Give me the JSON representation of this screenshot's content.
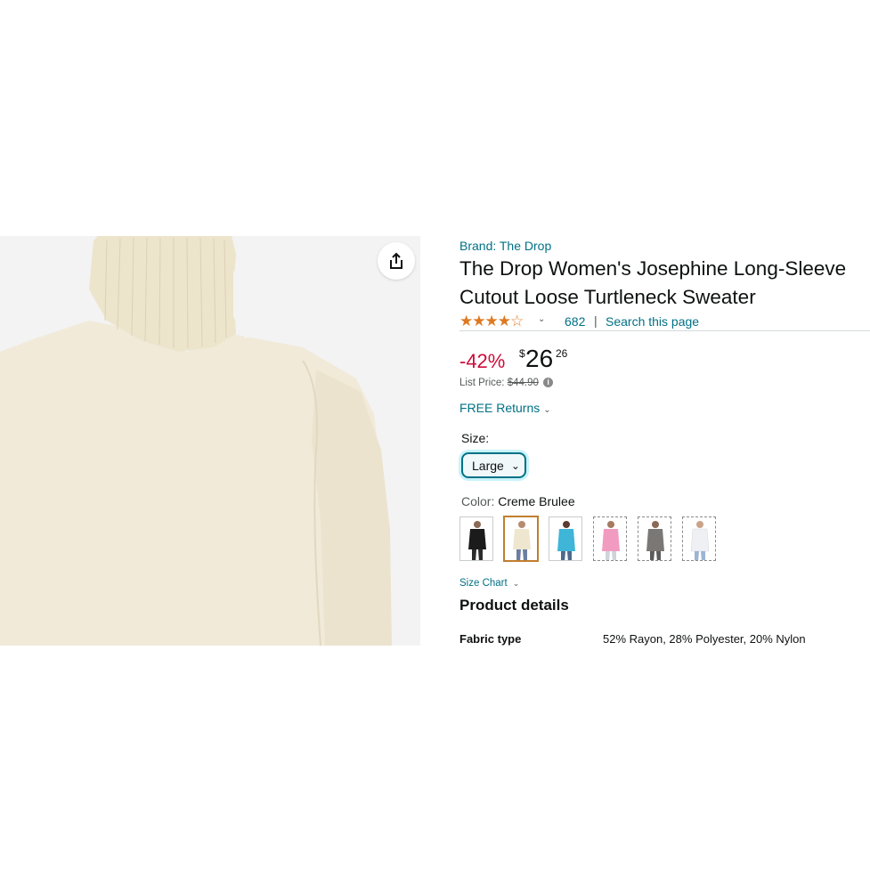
{
  "product": {
    "brand": "Brand: The Drop",
    "title_line1": "The Drop Women's Josephine Long-Sleeve",
    "title_line2": "Cutout Loose Turtleneck Sweater",
    "image_color": "#f1ead9"
  },
  "rating": {
    "stars": 4,
    "count": "682",
    "separator": "|",
    "search_link": "Search this page",
    "star_color": "#de7921"
  },
  "price": {
    "discount": "-42%",
    "currency": "$",
    "whole": "26",
    "fraction": "26",
    "list_price_label": "List Price:",
    "list_price_value": "$44.90",
    "discount_color": "#cc0c39"
  },
  "returns": {
    "label": "FREE Returns"
  },
  "size": {
    "label": "Size:",
    "selected": "Large"
  },
  "color": {
    "label": "Color:",
    "selected": "Creme Brulee",
    "swatches": [
      {
        "name": "black",
        "hex": "#1b1b1b"
      },
      {
        "name": "creme-brulee",
        "hex": "#efe6cf"
      },
      {
        "name": "blue",
        "hex": "#3fb5d8"
      },
      {
        "name": "pink",
        "hex": "#f29bc1"
      },
      {
        "name": "grey",
        "hex": "#7b7774"
      },
      {
        "name": "white",
        "hex": "#f4f5f7"
      }
    ]
  },
  "size_chart": {
    "label": "Size Chart"
  },
  "product_details": {
    "heading": "Product details",
    "rows": [
      {
        "key": "Fabric type",
        "value": "52% Rayon, 28% Polyester, 20% Nylon"
      }
    ]
  },
  "icons": {
    "share": "share-icon",
    "chevron": "chevron-down-icon",
    "info": "info-icon"
  }
}
